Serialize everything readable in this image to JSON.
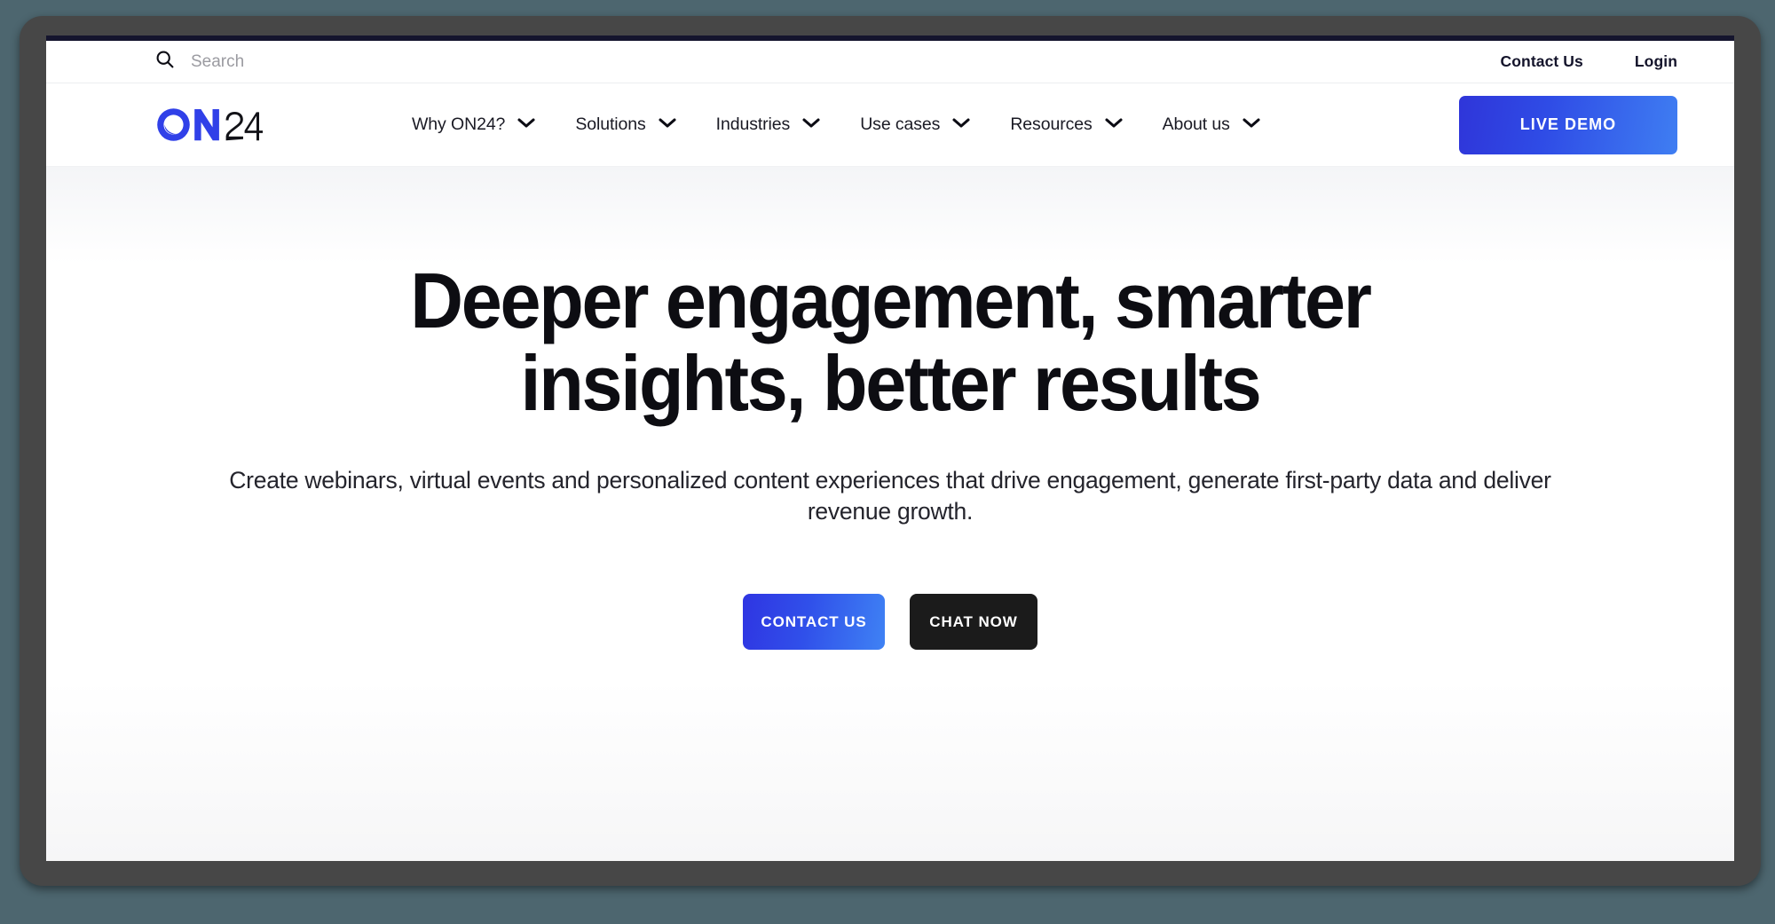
{
  "utility_bar": {
    "search": {
      "icon": "search-icon",
      "placeholder": "Search",
      "value": ""
    },
    "links": [
      {
        "label": "Contact Us"
      },
      {
        "label": "Login"
      }
    ]
  },
  "main_nav": {
    "logo": {
      "text_primary": "ON",
      "text_secondary": "24",
      "primary_color": "#3040e8",
      "secondary_color": "#121217"
    },
    "items": [
      {
        "label": "Why ON24?",
        "icon": "chevron-down-icon"
      },
      {
        "label": "Solutions",
        "icon": "chevron-down-icon"
      },
      {
        "label": "Industries",
        "icon": "chevron-down-icon"
      },
      {
        "label": "Use cases",
        "icon": "chevron-down-icon"
      },
      {
        "label": "Resources",
        "icon": "chevron-down-icon"
      },
      {
        "label": "About us",
        "icon": "chevron-down-icon"
      }
    ],
    "cta": {
      "label": "LIVE DEMO",
      "gradient_from": "#2f35d9",
      "gradient_to": "#3f7ef2"
    }
  },
  "hero": {
    "title": "Deeper engagement, smarter insights, better results",
    "subtitle": "Create webinars, virtual events and personalized content experiences that drive engagement, generate first-party data and deliver revenue growth.",
    "buttons": [
      {
        "label": "CONTACT US",
        "style": "primary",
        "color": "#3050ea"
      },
      {
        "label": "CHAT NOW",
        "style": "secondary",
        "color": "#1b1b1b"
      }
    ]
  },
  "theme": {
    "page_background": "#4d666f",
    "bezel": "#474747",
    "top_strip": "#15152e"
  }
}
